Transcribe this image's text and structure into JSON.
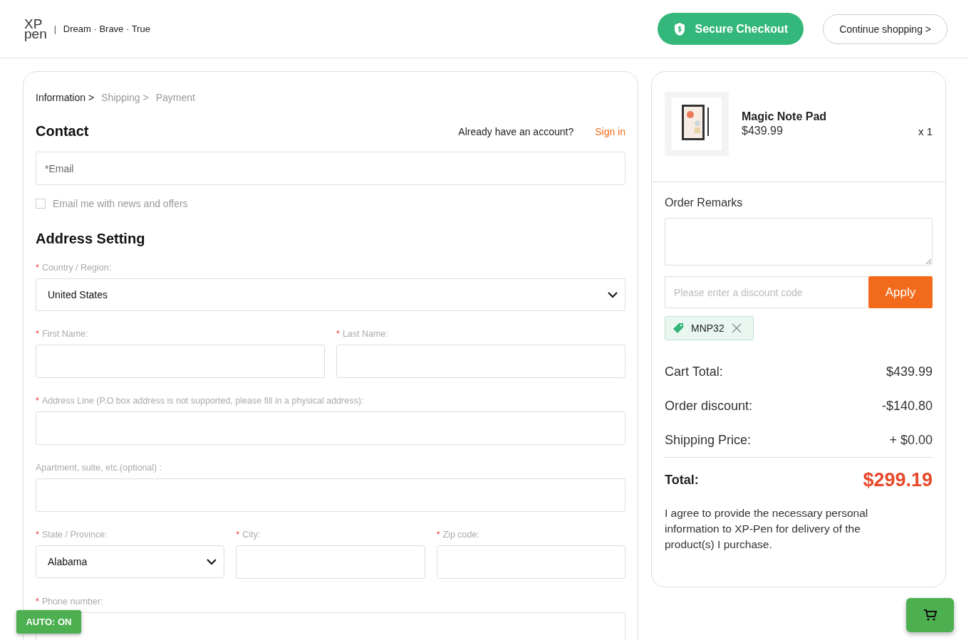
{
  "header": {
    "logo_top": "XP",
    "logo_bottom": "pen",
    "divider": "|",
    "tagline": "Dream · Brave · True",
    "secure_button": "Secure Checkout",
    "continue_button": "Continue shopping >"
  },
  "breadcrumb": [
    {
      "label": "Information >",
      "selected": true
    },
    {
      "label": "Shipping >",
      "selected": false
    },
    {
      "label": "Payment",
      "selected": false
    }
  ],
  "contact": {
    "title": "Contact",
    "account_prompt": "Already have an account?",
    "sign_in": "Sign in",
    "email_placeholder": "*Email",
    "newsletter": {
      "label": "Email me with news and offers",
      "checked": false
    }
  },
  "address": {
    "title": "Address Setting",
    "rows": [
      [
        {
          "marker": "*",
          "label": "Country / Region:",
          "kind": "select",
          "value": "United States"
        }
      ],
      [
        {
          "marker": "*",
          "label": "First Name:",
          "kind": "text"
        },
        {
          "marker": "*",
          "label": "Last Name:",
          "kind": "text"
        }
      ],
      [
        {
          "marker": "*",
          "label": "Address Line (P.O box address is not supported, please fill in a physical address):",
          "kind": "text"
        }
      ],
      [
        {
          "label": "Apartment, suite, etc.(optional) :",
          "kind": "text"
        }
      ],
      [
        {
          "marker": "*",
          "label": "State / Province:",
          "kind": "select",
          "value": "Alabama"
        },
        {
          "marker": "*",
          "label": "City:",
          "kind": "text"
        },
        {
          "marker": "*",
          "label": "Zip code:",
          "kind": "text"
        }
      ],
      [
        {
          "marker": "*",
          "label": "Phone number:",
          "kind": "text"
        }
      ]
    ]
  },
  "order": {
    "product": {
      "name": "Magic Note Pad",
      "price": "$439.99",
      "quantity": "x 1"
    },
    "remarks_label": "Order Remarks",
    "discount_placeholder": "Please enter a discount code",
    "apply_button": "Apply",
    "coupon": "MNP32",
    "summary": [
      {
        "label": "Cart Total:",
        "value": "$439.99"
      },
      {
        "label": "Order discount:",
        "value": "-$140.80"
      },
      {
        "label": "Shipping Price:",
        "value": "+ $0.00"
      }
    ],
    "total_label": "Total:",
    "total_value": "$299.19",
    "agreement": "I agree to provide the necessary personal information to XP-Pen for delivery of the product(s) I purchase."
  },
  "auto_badge": "AUTO: ON"
}
